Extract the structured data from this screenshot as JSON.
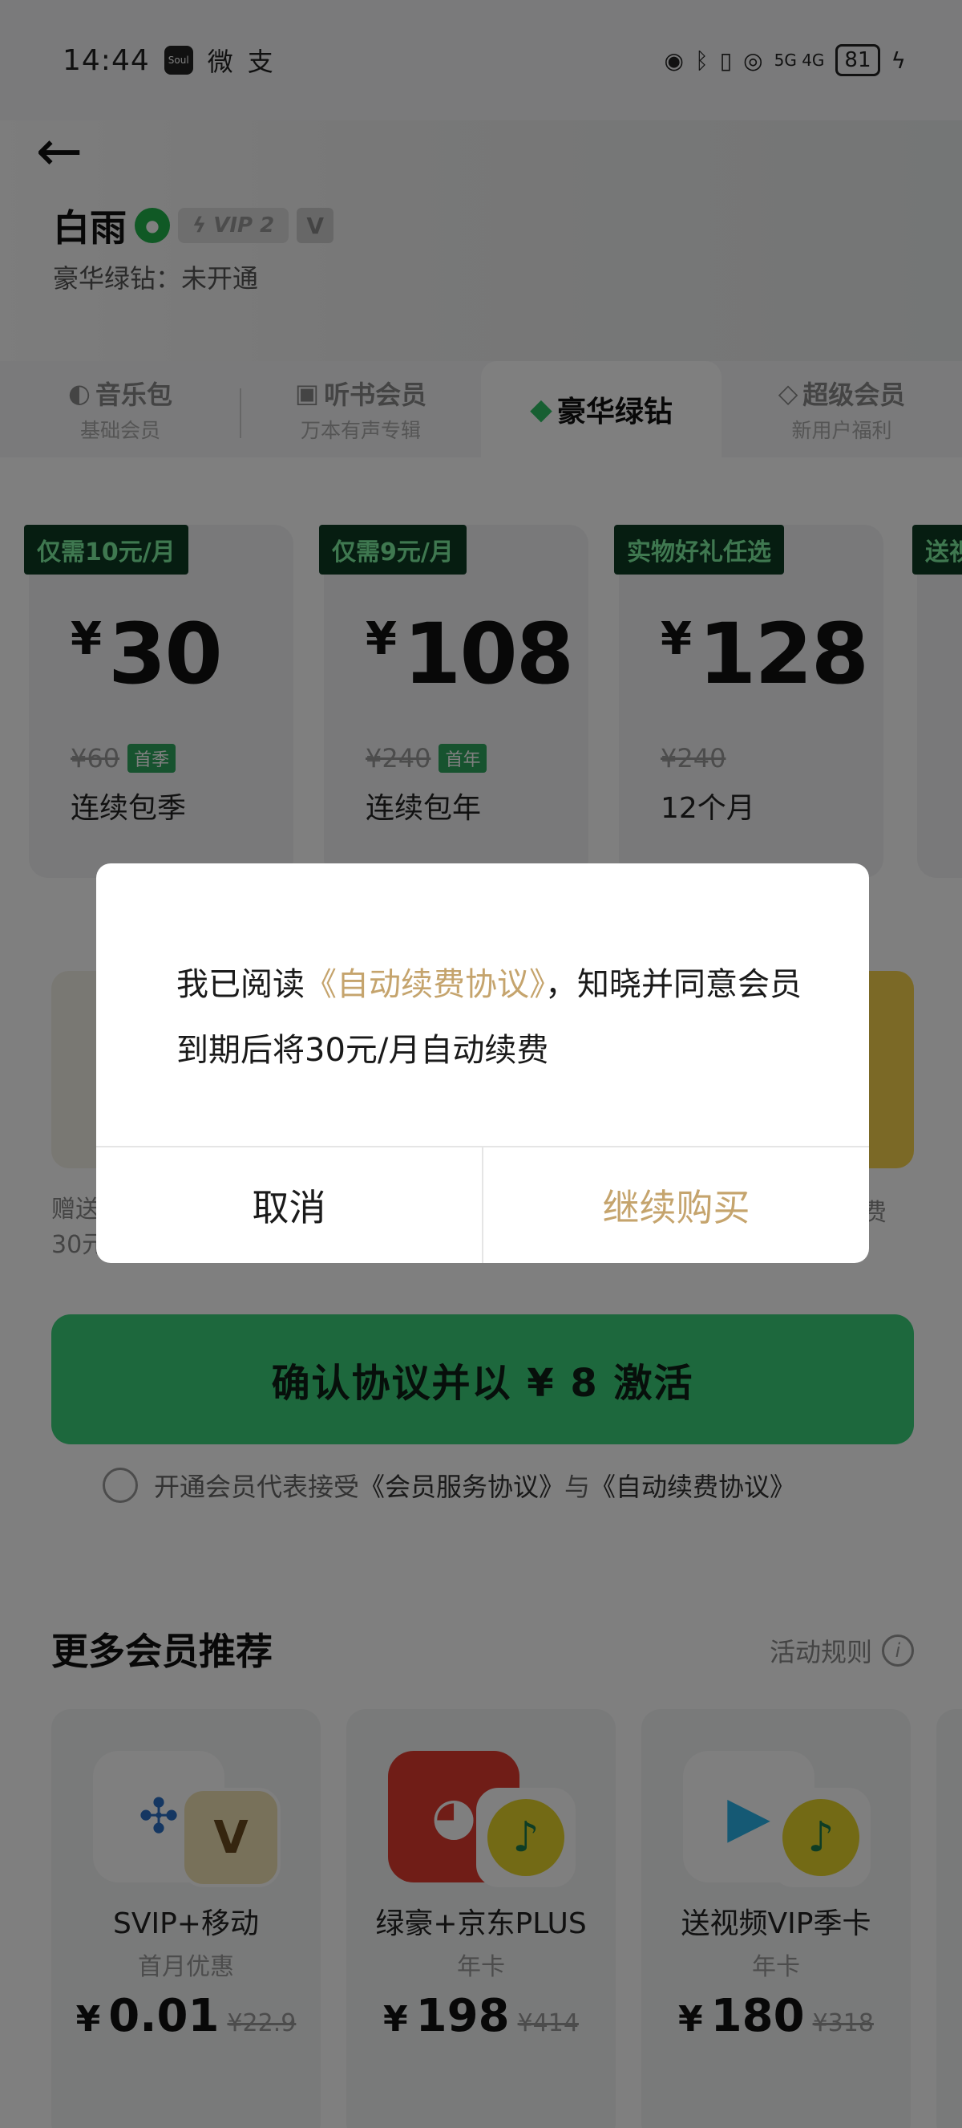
{
  "status_bar": {
    "time": "14:44",
    "app_icons": [
      "Soul",
      "微",
      "支"
    ],
    "network": "5G 4G",
    "battery": "81"
  },
  "header": {
    "back_icon": "back-arrow-icon",
    "user_name": "白雨",
    "vip_level": "VIP 2",
    "v_badge": "V",
    "membership_status": "豪华绿钻：未开通"
  },
  "tabs": [
    {
      "title": "音乐包",
      "sub": "基础会员",
      "icon": "music-pack-icon"
    },
    {
      "title": "听书会员",
      "sub": "万本有声专辑",
      "icon": "audiobook-icon"
    },
    {
      "title": "豪华绿钻",
      "sub": "",
      "icon": "green-diamond-icon",
      "active": true
    },
    {
      "title": "超级会员",
      "sub": "新用户福利",
      "icon": "super-vip-icon"
    }
  ],
  "plans": [
    {
      "tag": "仅需10元/月",
      "currency": "¥",
      "price": "30",
      "original": "¥60",
      "badge": "首季",
      "name": "连续包季"
    },
    {
      "tag": "仅需9元/月",
      "currency": "¥",
      "price": "108",
      "original": "¥240",
      "badge": "首年",
      "name": "连续包年"
    },
    {
      "tag": "实物好礼任选",
      "currency": "¥",
      "price": "128",
      "original": "¥240",
      "badge": "",
      "name": "12个月"
    },
    {
      "tag": "送视",
      "currency": "¥",
      "price": "",
      "original": "",
      "badge": "",
      "name": ""
    }
  ],
  "gifts": {
    "left_desc_line1": "赠送",
    "left_desc_line2": "30元",
    "right_desc": "费"
  },
  "cta": {
    "label": "确认协议并以 ¥ 8 激活"
  },
  "agreement": {
    "text": "开通会员代表接受",
    "link1": "《会员服务协议》",
    "and": "与",
    "link2": "《自动续费协议》"
  },
  "more_section": {
    "title": "更多会员推荐",
    "rules": "活动规则"
  },
  "recommendations": [
    {
      "name": "SVIP+移动",
      "sub": "首月优惠",
      "currency": "¥",
      "price": "0.01",
      "original": "¥22.9",
      "icon_a": "china-mobile-icon",
      "icon_b": "svip-icon"
    },
    {
      "name": "绿豪+京东PLUS",
      "sub": "年卡",
      "currency": "¥",
      "price": "198",
      "original": "¥414",
      "icon_a": "jd-icon",
      "icon_b": "qq-music-icon"
    },
    {
      "name": "送视频VIP季卡",
      "sub": "年卡",
      "currency": "¥",
      "price": "180",
      "original": "¥318",
      "icon_a": "tencent-video-icon",
      "icon_b": "qq-music-icon"
    }
  ],
  "dialog": {
    "text_before": "我已阅读",
    "link": "《自动续费协议》",
    "text_after": "，知晓并同意会员到期后将30元/月自动续费",
    "cancel": "取消",
    "continue": "继续购买"
  },
  "colors": {
    "accent_green": "#3ad07a",
    "gold": "#c5a46d",
    "tag_bg": "#0d3a22"
  }
}
